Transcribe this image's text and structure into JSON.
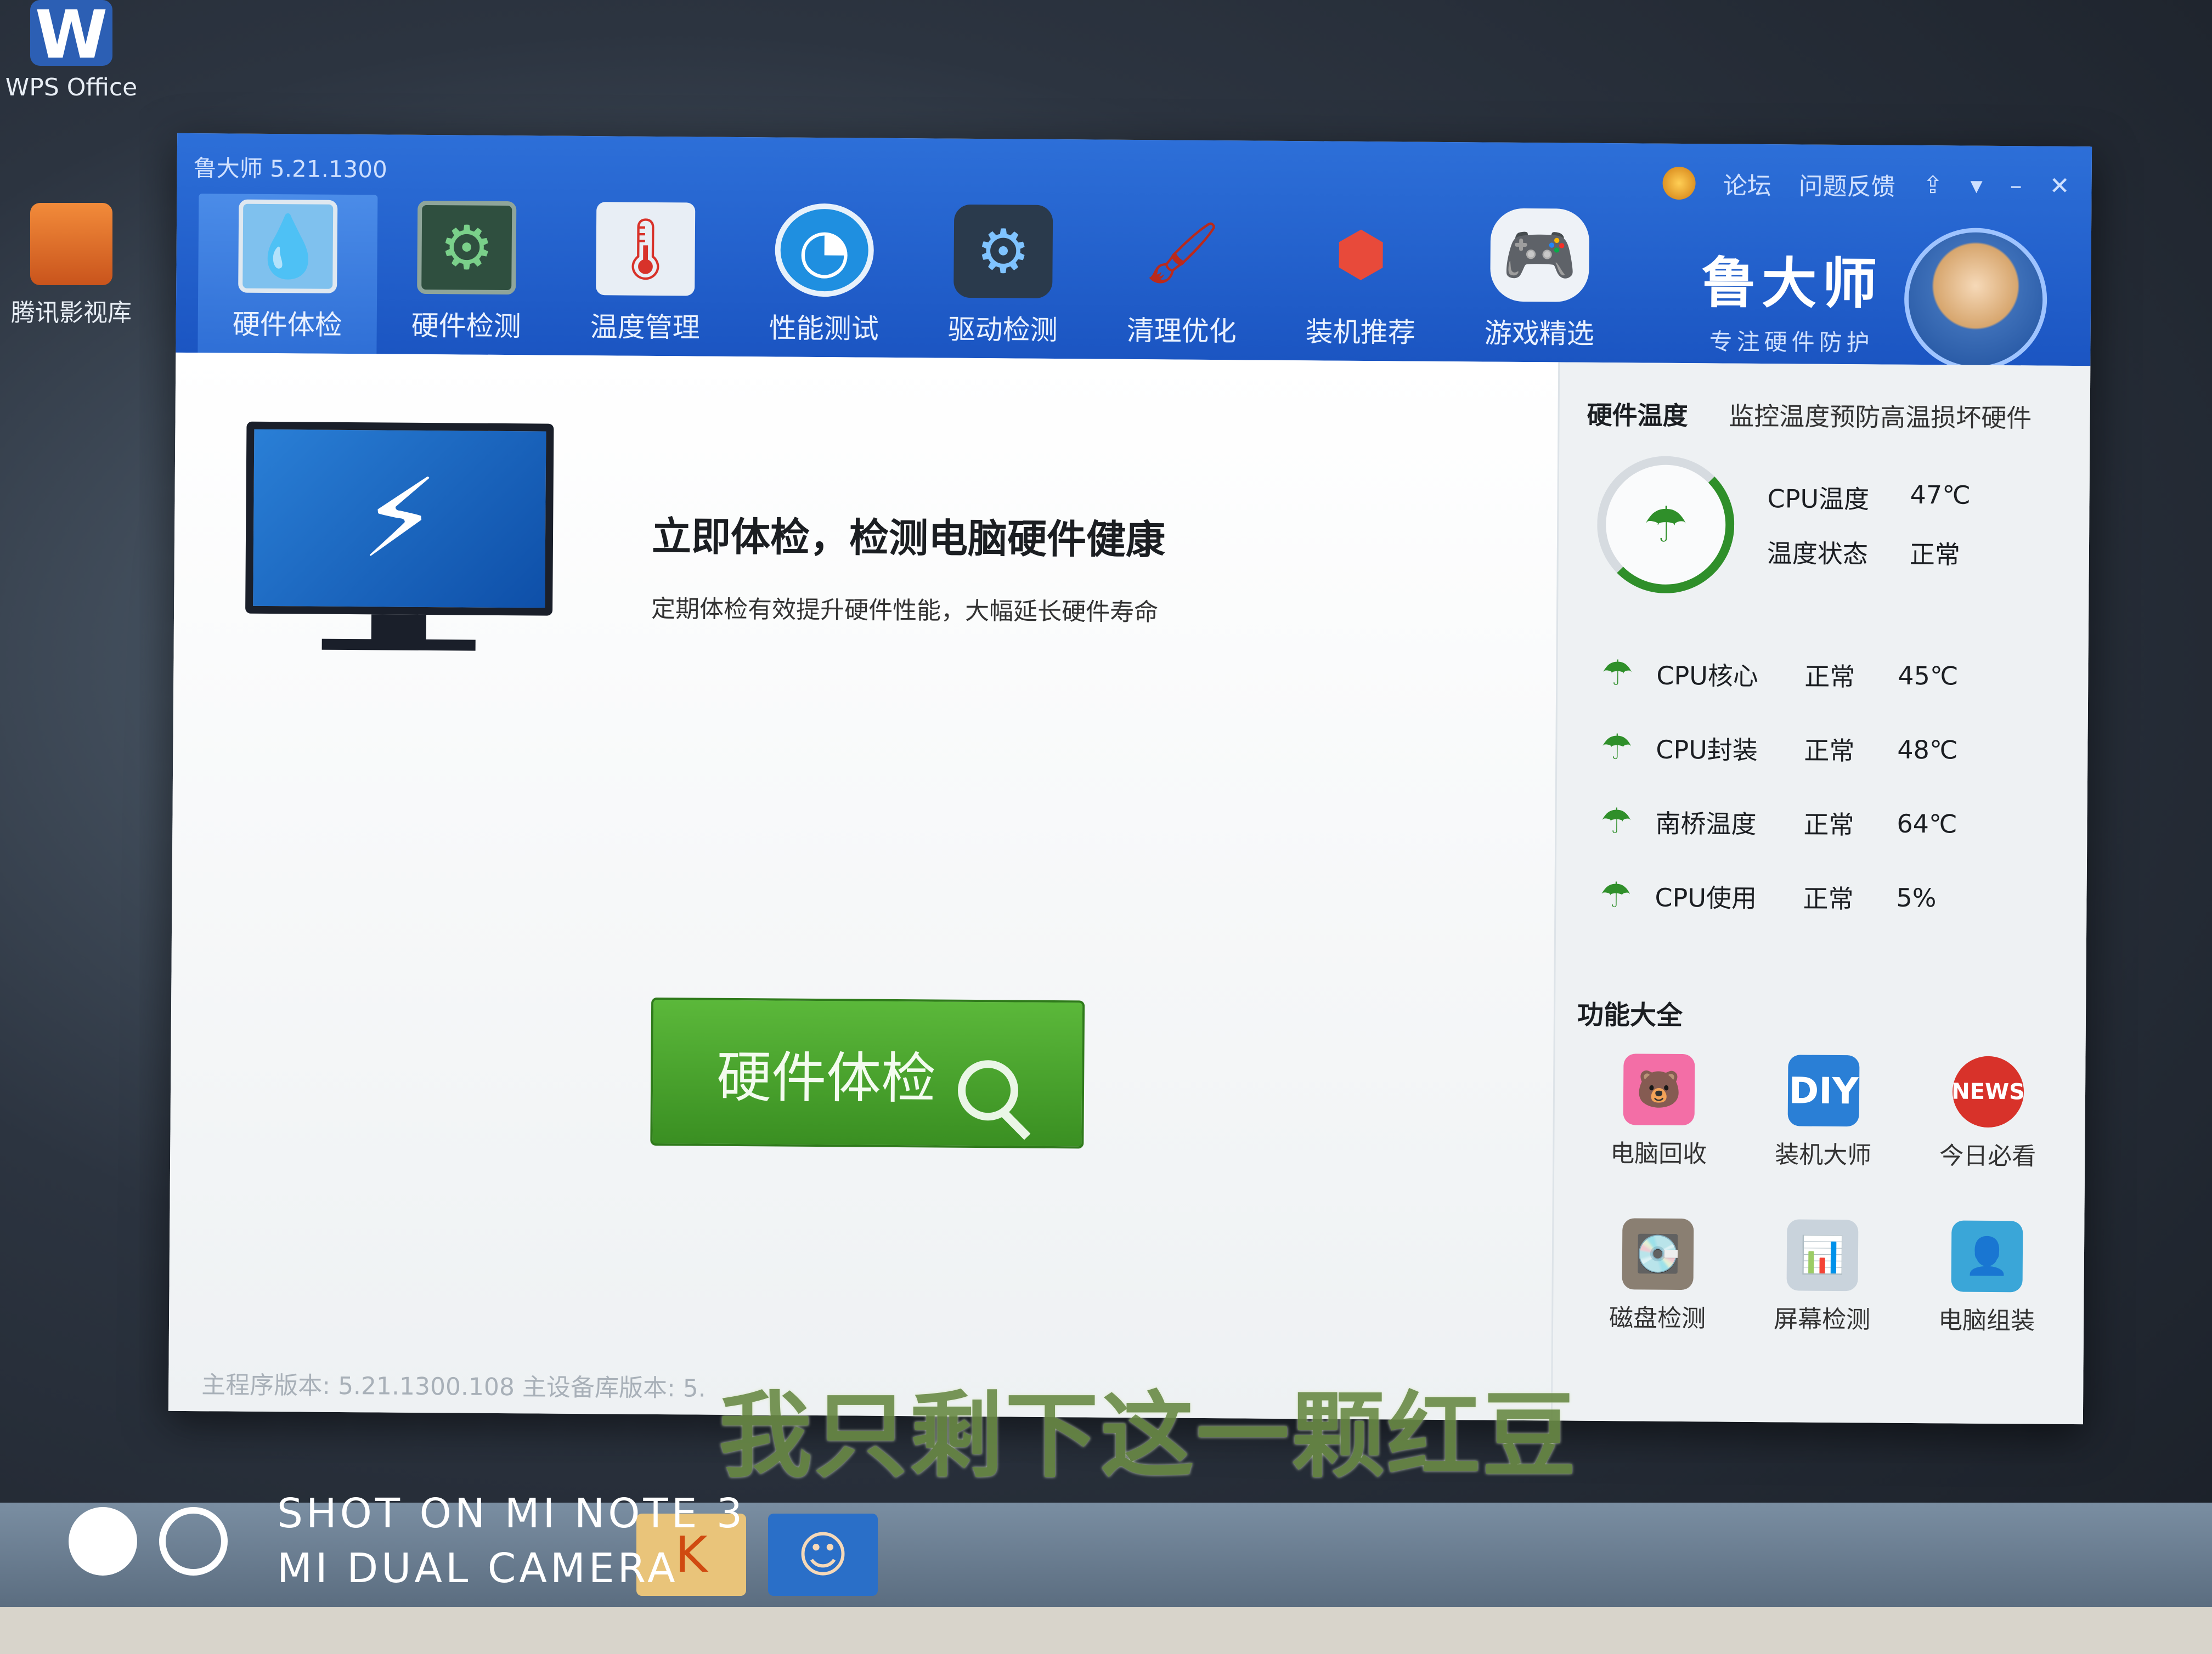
{
  "desktop": {
    "icons": [
      {
        "label": "WPS Office"
      },
      {
        "label": "腾讯影视库"
      }
    ]
  },
  "window": {
    "title": "鲁大师 5.21.1300",
    "controls": {
      "forum": "论坛",
      "feedback": "问题反馈",
      "upload": "⇪",
      "menu": "▾",
      "minimize": "–",
      "close": "✕"
    }
  },
  "toolbar": {
    "active_index": 0,
    "items": [
      {
        "label": "硬件体检",
        "glyph": "💧"
      },
      {
        "label": "硬件检测",
        "glyph": "⚙"
      },
      {
        "label": "温度管理",
        "glyph": "🌡"
      },
      {
        "label": "性能测试",
        "glyph": "◔"
      },
      {
        "label": "驱动检测",
        "glyph": "⚙"
      },
      {
        "label": "清理优化",
        "glyph": "🖌"
      },
      {
        "label": "装机推荐",
        "glyph": "⬢"
      },
      {
        "label": "游戏精选",
        "glyph": "🎮"
      }
    ]
  },
  "brand": {
    "name": "鲁大师",
    "slogan": "专注硬件防护"
  },
  "main": {
    "headline": "立即体检，检测电脑硬件健康",
    "subline": "定期体检有效提升硬件性能，大幅延长硬件寿命",
    "check_button_label": "硬件体检",
    "version_text": "主程序版本: 5.21.1300.108   主设备库版本: 5."
  },
  "sidebar": {
    "temp_title": "硬件温度",
    "temp_subtitle": "监控温度预防高温损坏硬件",
    "cpu_temp_label": "CPU温度",
    "cpu_temp_value": "47℃",
    "status_label": "温度状态",
    "status_value": "正常",
    "rows": [
      {
        "label": "CPU核心",
        "status": "正常",
        "value": "45℃"
      },
      {
        "label": "CPU封装",
        "status": "正常",
        "value": "48℃"
      },
      {
        "label": "南桥温度",
        "status": "正常",
        "value": "64℃"
      },
      {
        "label": "CPU使用",
        "status": "正常",
        "value": "5%"
      }
    ],
    "functions_title": "功能大全",
    "functions": [
      {
        "label": "电脑回收",
        "glyph": "🐻"
      },
      {
        "label": "装机大师",
        "glyph": "DIY"
      },
      {
        "label": "今日必看",
        "glyph": "NEWS"
      },
      {
        "label": "磁盘检测",
        "glyph": "💽"
      },
      {
        "label": "屏幕检测",
        "glyph": "📊"
      },
      {
        "label": "电脑组装",
        "glyph": "👤"
      }
    ]
  },
  "overlay": {
    "lyric": "我只剩下这一颗红豆"
  },
  "taskbar": {
    "apps": [
      {
        "glyph": "K"
      },
      {
        "glyph": "☺"
      }
    ]
  },
  "watermark": {
    "line1": "SHOT ON MI NOTE 3",
    "line2": "MI DUAL CAMERA"
  }
}
